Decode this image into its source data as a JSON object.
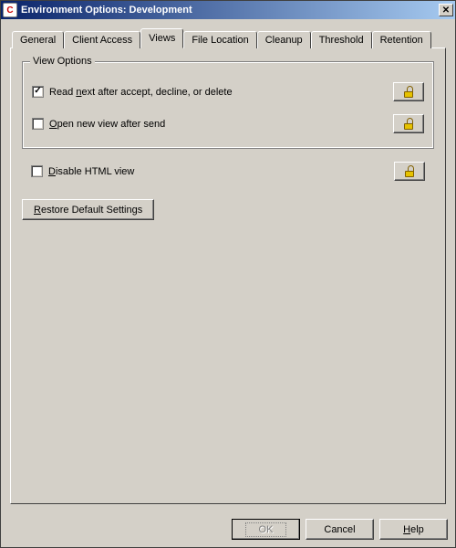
{
  "window": {
    "title": "Environment Options:  Development"
  },
  "tabs": [
    {
      "label": "General"
    },
    {
      "label": "Client Access"
    },
    {
      "label": "Views"
    },
    {
      "label": "File Location"
    },
    {
      "label": "Cleanup"
    },
    {
      "label": "Threshold"
    },
    {
      "label": "Retention"
    }
  ],
  "group": {
    "legend": "View Options",
    "opt1_pre": "Read ",
    "opt1_mn": "n",
    "opt1_post": "ext after accept, decline, or delete",
    "opt2_pre": "",
    "opt2_mn": "O",
    "opt2_post": "pen new view after send"
  },
  "standalone": {
    "opt3_pre": "",
    "opt3_mn": "D",
    "opt3_post": "isable HTML view"
  },
  "buttons": {
    "restore_mn": "R",
    "restore_post": "estore Default Settings",
    "ok": "OK",
    "cancel": "Cancel",
    "help_mn": "H",
    "help_post": "elp"
  }
}
